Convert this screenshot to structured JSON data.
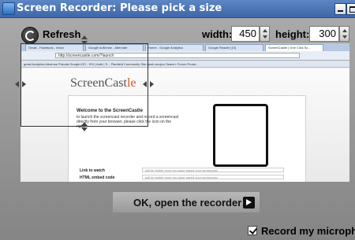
{
  "window": {
    "title": "Screen Recorder: Please pick a size"
  },
  "toolbar": {
    "refresh_label": "Refresh",
    "width_label": "width:",
    "width_value": "450",
    "height_label": "height:",
    "height_value": "300"
  },
  "preview": {
    "tabs": [
      "Gmail - Facebook - Inbox",
      "Google AdSense - Alternate",
      "Home - Google Analytics",
      "Google Reader (10)",
      "ScreenCastle | One Click Sc..."
    ],
    "address": "http://screencastle.com/?launch",
    "bookmarks": "gmail  Analytics  Adsense  Fistoda  Google  iGS - SSI | Auth | S...  Planfield Community Site  geek woojoo  Search: Forum Produ...",
    "logo_text": "ScreenCast",
    "logo_accent": "le",
    "card_heading": "Welcome to the ScreenCastle",
    "card_text": "to launch the screencast recorder and record a screencast directly from your browser, please click the icon on the right",
    "fields": [
      {
        "label": "Link to watch",
        "placeholder": "will be visible once you have saved your screencast"
      },
      {
        "label": "HTML embed code",
        "placeholder": "will be visible once you have saved your screencast"
      }
    ]
  },
  "ok_button": {
    "label": "OK, open the recorder"
  },
  "record_mic": {
    "label": "Record my micropho",
    "checked": true
  },
  "colors": {
    "title_bar": "#4a75b8",
    "logo_accent": "#d9541e"
  }
}
